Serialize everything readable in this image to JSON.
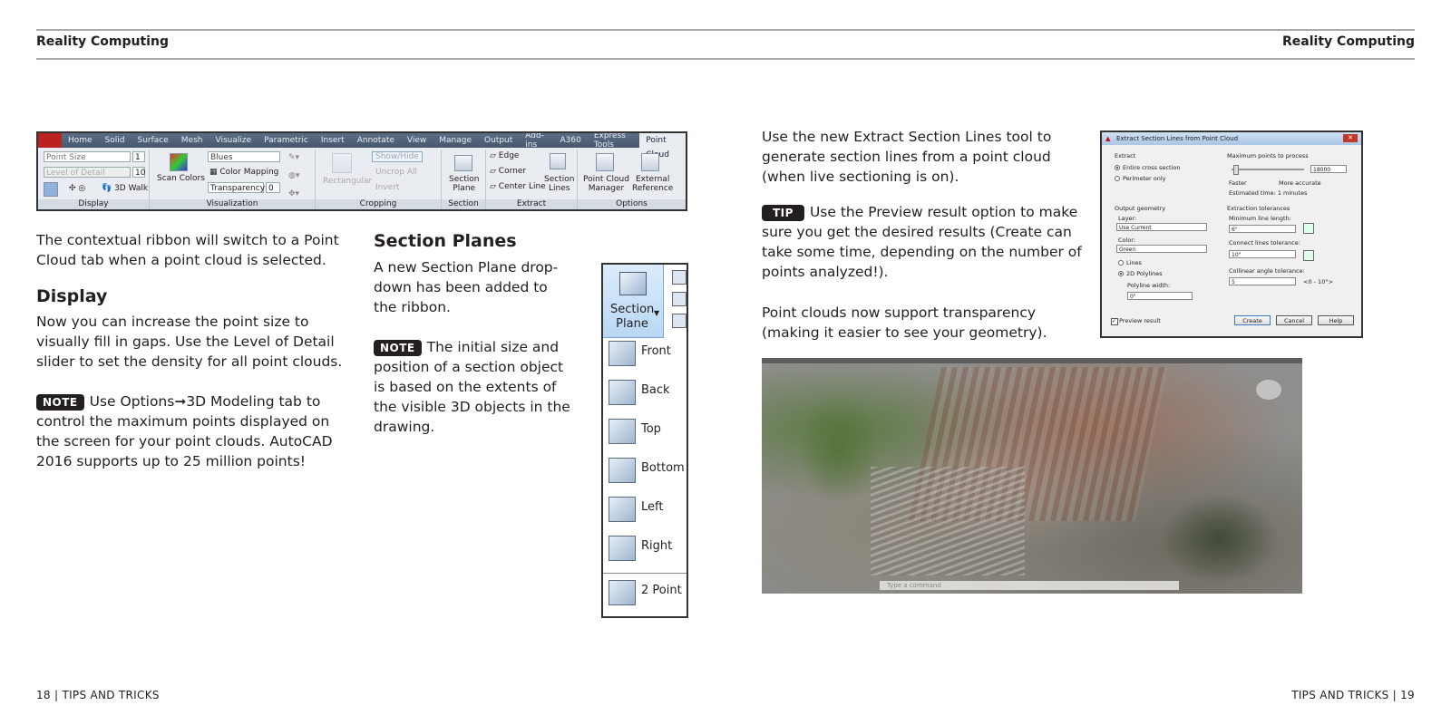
{
  "header": {
    "left_title": "Reality Computing",
    "right_title": "Reality Computing"
  },
  "ribbon": {
    "tabs": [
      "Home",
      "Solid",
      "Surface",
      "Mesh",
      "Visualize",
      "Parametric",
      "Insert",
      "Annotate",
      "View",
      "Manage",
      "Output",
      "Add-ins",
      "A360",
      "Express Tools",
      "Point Cloud"
    ],
    "active_tab": "Point Cloud",
    "display": {
      "point_size_label": "Point Size",
      "point_size_value": "1",
      "level_of_detail_label": "Level of Detail",
      "level_of_detail_value": "10",
      "walk_label": "3D Walk",
      "panel_title": "Display"
    },
    "visualization": {
      "scan_colors": "Scan Colors",
      "palette": "Blues",
      "color_mapping": "Color Mapping",
      "transparency_label": "Transparency",
      "transparency_value": "0",
      "panel_title": "Visualization"
    },
    "cropping": {
      "rectangular": "Rectangular",
      "show_hide": "Show/Hide",
      "uncrop_all": "Uncrop All",
      "invert": "Invert",
      "panel_title": "Cropping"
    },
    "section": {
      "plane_line1": "Section",
      "plane_line2": "Plane",
      "panel_title": "Section"
    },
    "extract": {
      "edge": "Edge",
      "corner": "Corner",
      "center_line": "Center Line",
      "section_lines_1": "Section",
      "section_lines_2": "Lines",
      "panel_title": "Extract"
    },
    "options": {
      "manager_1": "Point Cloud",
      "manager_2": "Manager",
      "external_1": "External",
      "external_2": "Reference",
      "panel_title": "Options"
    }
  },
  "left": {
    "intro": "The contextual ribbon will switch to a Point Cloud tab when a point cloud is selected.",
    "display_heading": "Display",
    "display_text": "Now you can increase the point size to visually fill in gaps. Use the Level of Detail slider to set the density for all point clouds.",
    "note_tag": "NOTE",
    "note_text": "Use Options➞3D Modeling tab to control the maximum points displayed on the screen for your point clouds. AutoCAD 2016 supports up to 25 million points!"
  },
  "section_planes": {
    "heading": "Section Planes",
    "text": "A new Section Plane drop-down has been added to the ribbon.",
    "note_tag": "NOTE",
    "note_text": "The initial size and position of a section object is based on the extents of the visible 3D objects in the drawing."
  },
  "dropdown": {
    "header_line1": "Section",
    "header_line2": "Plane",
    "items": [
      "Front",
      "Back",
      "Top",
      "Bottom",
      "Left",
      "Right",
      "2 Point"
    ]
  },
  "right": {
    "extract_text": "Use the new Extract Section Lines tool to generate section lines from a point cloud (when live sectioning is on).",
    "tip_tag": "TIP",
    "tip_text": "Use the Preview result option to make sure you get the desired results (Create can take some time, depending on the number of points analyzed!).",
    "transparency_text": "Point clouds now support transparency (making it easier to see your geometry)."
  },
  "dialog": {
    "title": "Extract Section Lines from Point Cloud",
    "extract_label": "Extract",
    "entire": "Entire cross section",
    "perimeter": "Perimeter only",
    "max_points_label": "Maximum points to process",
    "max_points_value": "18000",
    "faster": "Faster",
    "more_accurate": "More accurate",
    "estimated": "Estimated time: 1 minutes",
    "output_geometry": "Output geometry",
    "layer_label": "Layer:",
    "layer_value": "Use Current",
    "color_label": "Color:",
    "color_value": "Green",
    "lines": "Lines",
    "polylines": "2D Polylines",
    "polyline_width_label": "Polyline width:",
    "polyline_width_value": "0\"",
    "extraction_tolerances": "Extraction tolerances",
    "min_line_length_label": "Minimum line length:",
    "min_line_length_value": "6\"",
    "connect_label": "Connect lines tolerance:",
    "connect_value": "10\"",
    "collinear_label": "Collinear angle tolerance:",
    "collinear_value": "5",
    "collinear_range": "<0 - 10°>",
    "preview": "Preview result",
    "create": "Create",
    "cancel": "Cancel",
    "help": "Help"
  },
  "photo": {
    "command_placeholder": "Type a command"
  },
  "footer": {
    "left": "18 | TIPS AND TRICKS",
    "right": "TIPS AND TRICKS | 19"
  }
}
